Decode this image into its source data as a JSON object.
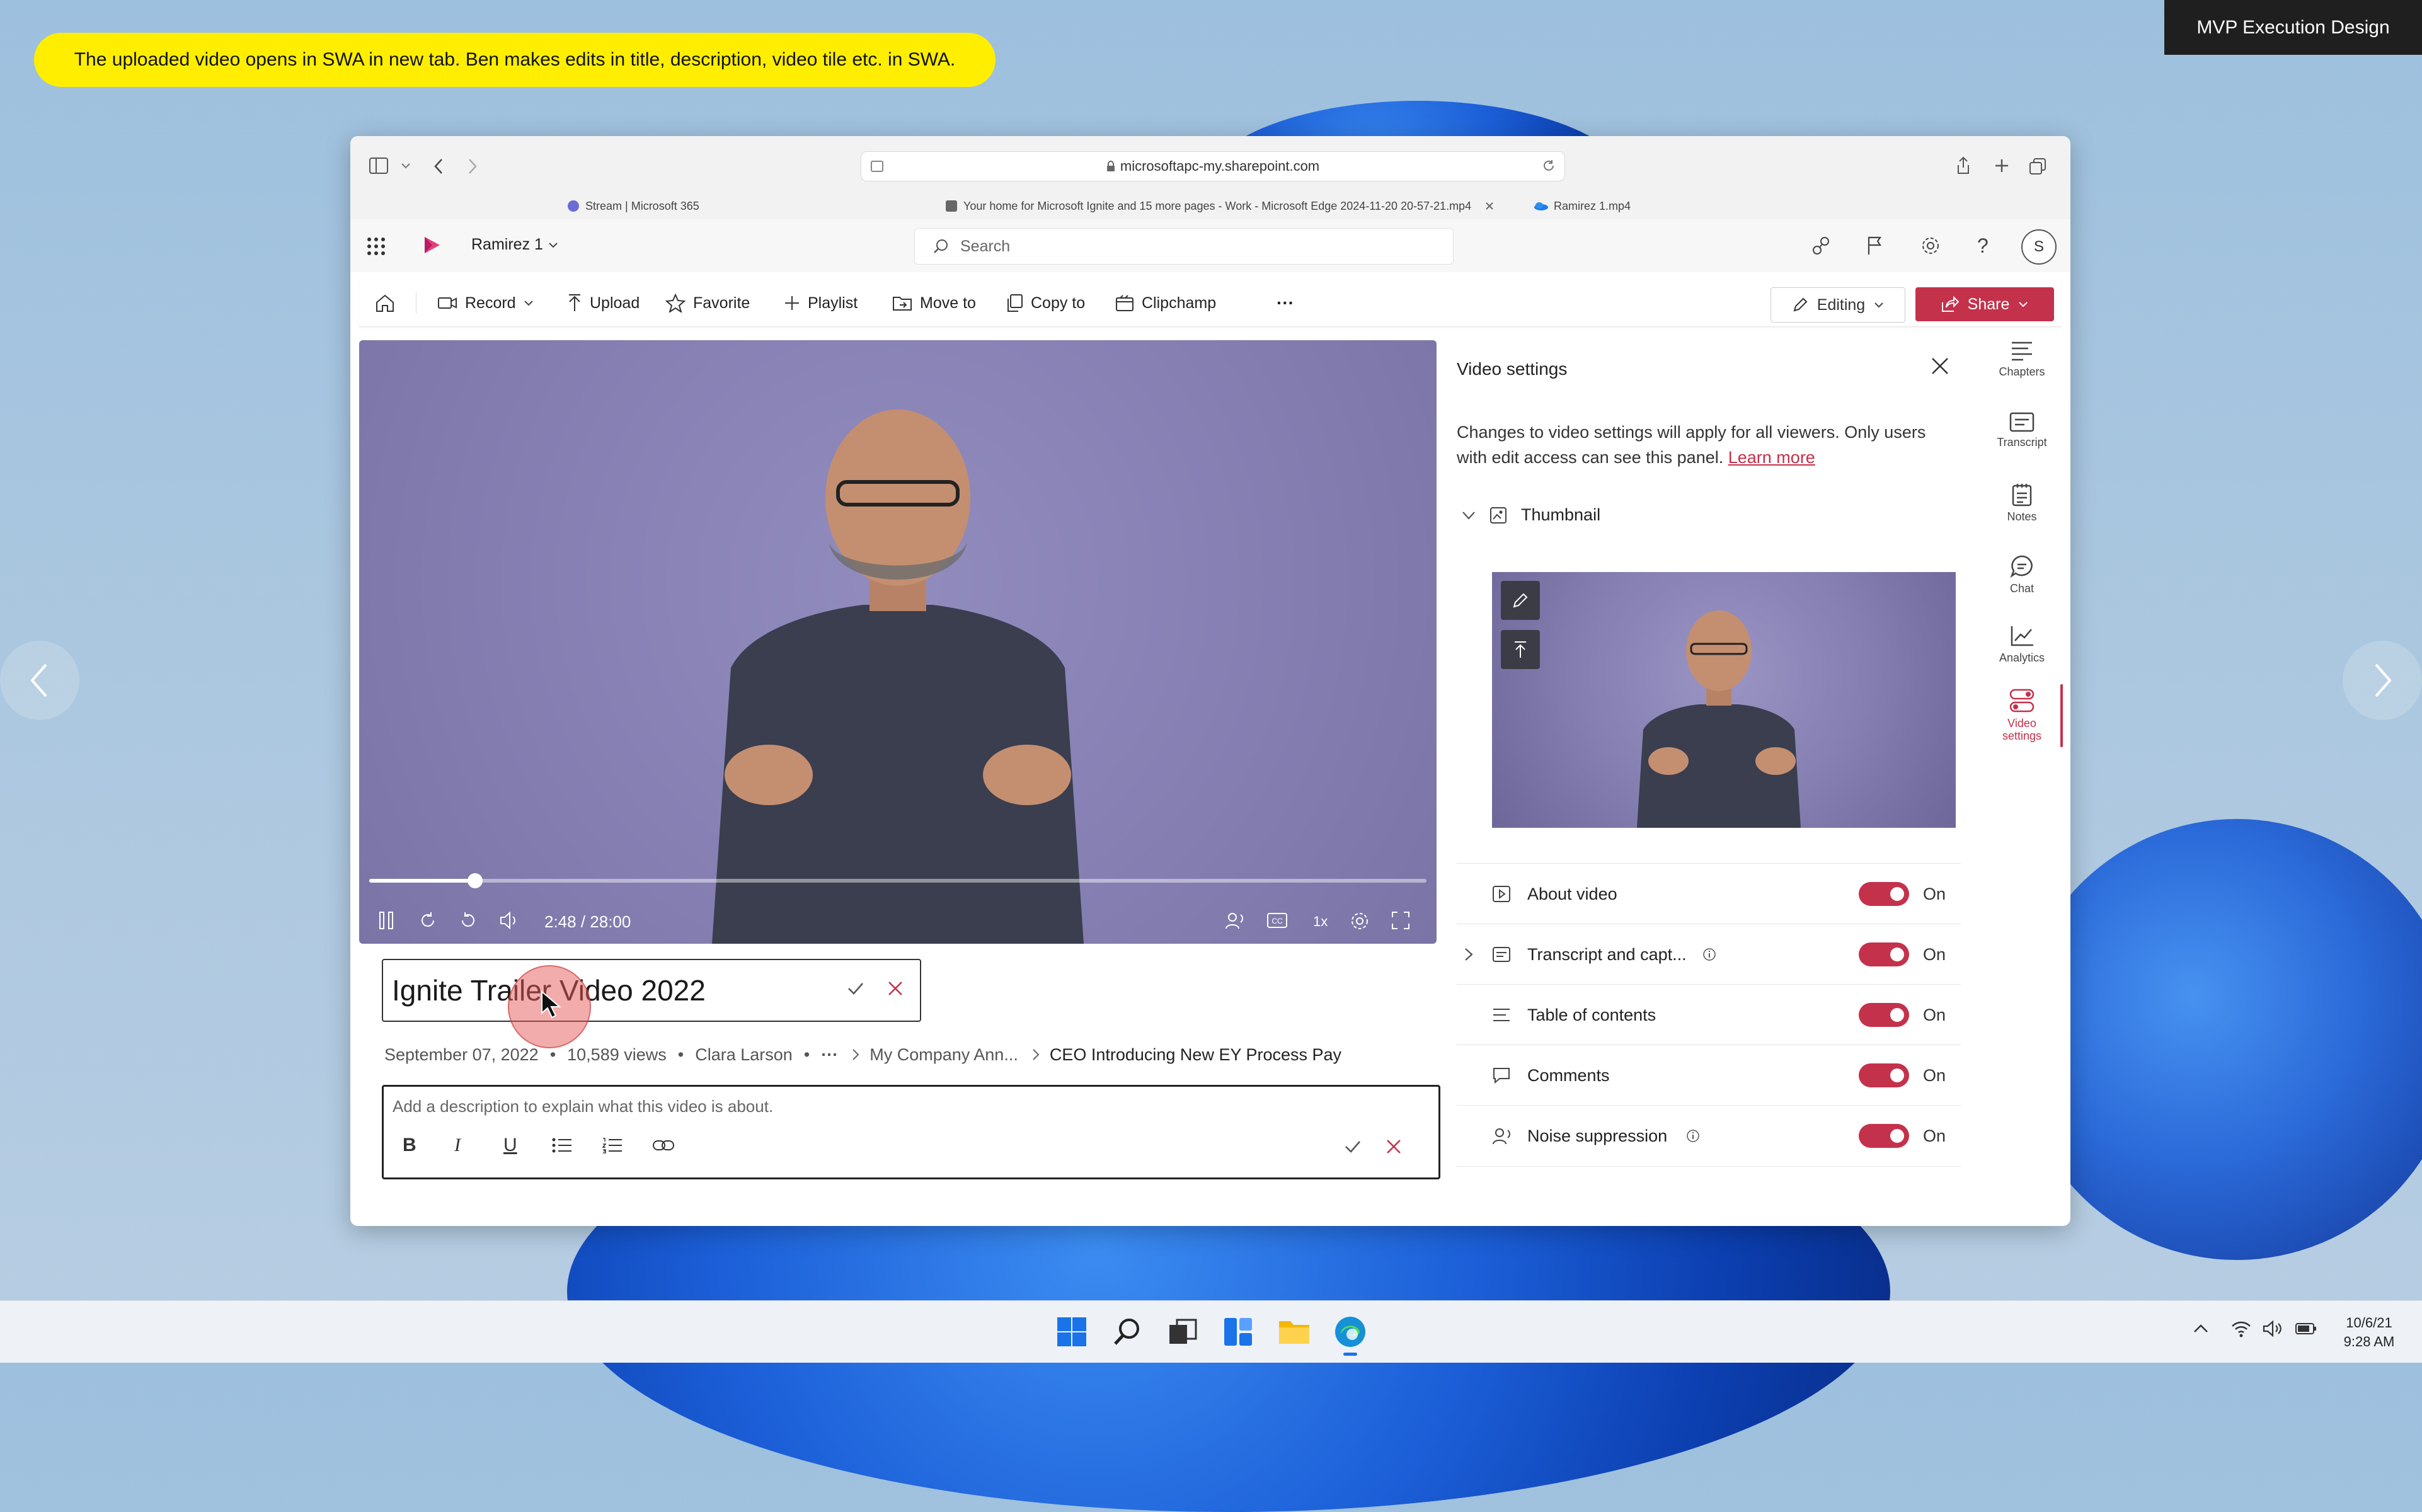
{
  "annotation": {
    "badge": "MVP Execution Design",
    "note": "The uploaded video opens in SWA in new tab. Ben makes edits in title, description, video tile etc. in SWA."
  },
  "browser": {
    "url": "microsoftapc-my.sharepoint.com",
    "tabs": [
      {
        "label": "Stream | Microsoft 365"
      },
      {
        "label": "Your home for Microsoft Ignite and 15 more pages - Work - Microsoft Edge 2024-11-20 20-57-21.mp4"
      },
      {
        "label": "Ramirez 1.mp4"
      }
    ]
  },
  "app": {
    "breadcrumb": "Ramirez 1",
    "search_placeholder": "Search",
    "avatar_initial": "S"
  },
  "commands": {
    "record": "Record",
    "upload": "Upload",
    "favorite": "Favorite",
    "playlist": "Playlist",
    "move_to": "Move to",
    "copy_to": "Copy to",
    "clipchamp": "Clipchamp",
    "more": "···",
    "editing": "Editing",
    "share": "Share"
  },
  "player": {
    "time": "2:48 / 28:00",
    "progress_fraction": 0.1,
    "speed": "1x"
  },
  "video": {
    "title": "Ignite Trailer Video 2022",
    "date": "September 07, 2022",
    "views": "10,589 views",
    "author": "Clara Larson",
    "ellipsis": "···",
    "crumb_1": "My Company Ann...",
    "crumb_2": "CEO Introducing New EY Process Pay",
    "description_placeholder": "Add a description to explain what this video is about."
  },
  "settings_panel": {
    "title": "Video settings",
    "info": "Changes to video settings will apply for all viewers. Only users with edit access can see this panel.",
    "learn_more": "Learn more",
    "thumbnail_label": "Thumbnail",
    "rows": [
      {
        "label": "About video",
        "state": "On"
      },
      {
        "label": "Transcript and capt...",
        "state": "On"
      },
      {
        "label": "Table of contents",
        "state": "On"
      },
      {
        "label": "Comments",
        "state": "On"
      },
      {
        "label": "Noise suppression",
        "state": "On"
      }
    ]
  },
  "rail": [
    {
      "label": "Chapters"
    },
    {
      "label": "Transcript"
    },
    {
      "label": "Notes"
    },
    {
      "label": "Chat"
    },
    {
      "label": "Analytics"
    },
    {
      "label": "Video settings"
    }
  ],
  "taskbar": {
    "date": "10/6/21",
    "time": "9:28 AM"
  },
  "colors": {
    "accent": "#c4314b",
    "note_bg": "#ffee00"
  }
}
